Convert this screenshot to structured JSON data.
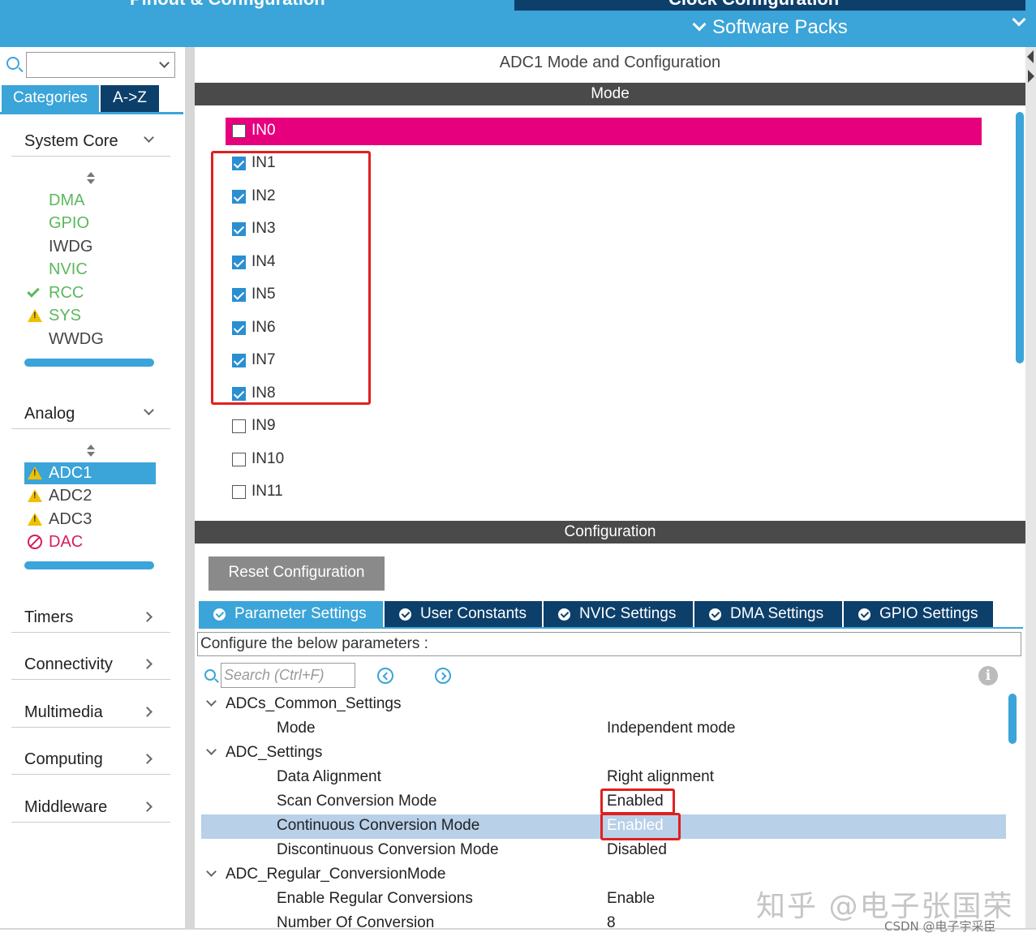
{
  "topbar": {
    "pinout_tab_label": "Pinout & Configuration",
    "clock_tab_label": "Clock Configuration",
    "software_packs_label": "Software Packs"
  },
  "sidebar": {
    "search_value": "",
    "tabs": {
      "categories": "Categories",
      "az": "A->Z"
    },
    "system_core": {
      "label": "System Core",
      "items": [
        {
          "label": "DMA",
          "status": "green"
        },
        {
          "label": "GPIO",
          "status": "green"
        },
        {
          "label": "IWDG",
          "status": "none"
        },
        {
          "label": "NVIC",
          "status": "green"
        },
        {
          "label": "RCC",
          "status": "check"
        },
        {
          "label": "SYS",
          "status": "warning"
        },
        {
          "label": "WWDG",
          "status": "none"
        }
      ]
    },
    "analog": {
      "label": "Analog",
      "items": [
        {
          "label": "ADC1",
          "status": "warning",
          "selected": true
        },
        {
          "label": "ADC2",
          "status": "warning"
        },
        {
          "label": "ADC3",
          "status": "warning"
        },
        {
          "label": "DAC",
          "status": "disabled"
        }
      ]
    },
    "collapsed_categories": [
      "Timers",
      "Connectivity",
      "Multimedia",
      "Computing",
      "Middleware"
    ]
  },
  "main": {
    "title": "ADC1 Mode and Configuration",
    "mode_header": "Mode",
    "channels": [
      {
        "label": "IN0",
        "checked": false,
        "highlighted": true
      },
      {
        "label": "IN1",
        "checked": true
      },
      {
        "label": "IN2",
        "checked": true
      },
      {
        "label": "IN3",
        "checked": true
      },
      {
        "label": "IN4",
        "checked": true
      },
      {
        "label": "IN5",
        "checked": true
      },
      {
        "label": "IN6",
        "checked": true
      },
      {
        "label": "IN7",
        "checked": true
      },
      {
        "label": "IN8",
        "checked": true
      },
      {
        "label": "IN9",
        "checked": false
      },
      {
        "label": "IN10",
        "checked": false
      },
      {
        "label": "IN11",
        "checked": false
      }
    ],
    "configuration_header": "Configuration",
    "reset_button": "Reset Configuration",
    "config_tabs": [
      {
        "label": "Parameter Settings",
        "active": true
      },
      {
        "label": "User Constants"
      },
      {
        "label": "NVIC Settings"
      },
      {
        "label": "DMA Settings"
      },
      {
        "label": "GPIO Settings"
      }
    ],
    "description": "Configure the below parameters :",
    "param_search_placeholder": "Search (Ctrl+F)",
    "parameters": [
      {
        "type": "group",
        "label": "ADCs_Common_Settings"
      },
      {
        "type": "param",
        "name": "Mode",
        "value": "Independent mode"
      },
      {
        "type": "group",
        "label": "ADC_Settings"
      },
      {
        "type": "param",
        "name": "Data Alignment",
        "value": "Right alignment"
      },
      {
        "type": "param",
        "name": "Scan Conversion Mode",
        "value": "Enabled"
      },
      {
        "type": "param",
        "name": "Continuous Conversion Mode",
        "value": "Enabled",
        "selected": true
      },
      {
        "type": "param",
        "name": "Discontinuous Conversion Mode",
        "value": "Disabled"
      },
      {
        "type": "group",
        "label": "ADC_Regular_ConversionMode"
      },
      {
        "type": "param",
        "name": "Enable Regular Conversions",
        "value": "Enable"
      },
      {
        "type": "param",
        "name": "Number Of Conversion",
        "value": "8"
      }
    ]
  },
  "watermark": {
    "main": "知乎 @电子张国荣",
    "small": "CSDN @电子宇采臣"
  },
  "colors": {
    "accent": "#3ba4d8",
    "dark_tab": "#0d3f6b",
    "highlight_pink": "#e6007e",
    "annotation_red": "#e02020",
    "selected_row": "#b8d0e8"
  }
}
